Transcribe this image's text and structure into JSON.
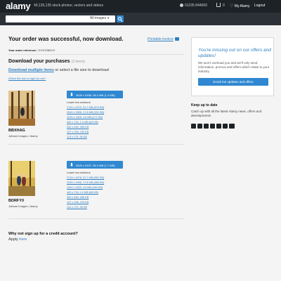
{
  "header": {
    "logo": "alamy",
    "tagline": "49,135,135 stock photos, vectors and videos",
    "phone": "01235 844600",
    "cart_count": "0",
    "my_alamy": "My Alamy",
    "logout": "Logout"
  },
  "search": {
    "value": "",
    "category": "All images"
  },
  "page": {
    "title": "Your order was successful, now download.",
    "printable_invoice": "Printable invoice",
    "order_reference_label": "Your order reference",
    "order_reference": "GYS72B5YG",
    "downloads_heading": "Download your purchases",
    "downloads_count": "(2 items)",
    "download_multiple": "Download multiple items",
    "download_multiple_suffix": "or select a file size to download",
    "which_size": "Which file size is right for me?",
    "credit_question": "Why not sign up for a credit account?",
    "apply_prefix": "Apply",
    "apply_link": "here"
  },
  "items": [
    {
      "id": "BBXHAG",
      "credit": "Jotham Images / Alamy",
      "main_download": "3626 x 5456, 56.4 MB (1.4 MB)",
      "lower_title": "Lower res versions",
      "lower_res": [
        "2720 x 4079, 31.7 MB (870 KB)",
        "2040 x 3058, 17.8 MB (531 KB)",
        "1020 x 1529, 4.5 MB (171 KB)",
        "490 x 734, 1.0 MB (63 KB)",
        "300 x 450, 396 KB",
        "197 x 296, 153 KB",
        "113 x 170, 56 KB"
      ]
    },
    {
      "id": "BDRFY0",
      "credit": "Jotham Images / Alamy",
      "main_download": "3625 x 5437, 56.4 MB (1.7 MB)",
      "lower_title": "Lower res versions",
      "lower_res": [
        "2719 x 4078, 31.7 MB (862 KB)",
        "2039 x 3058, 17.8 MB (588 KB)",
        "1020 x 1529, 4.5 MB (180 KB)",
        "490 x 734, 1.0 MB (66 KB)",
        "300 x 450, 396 KB",
        "197 x 296, 153 KB",
        "113 x 170, 56 KB"
      ]
    }
  ],
  "promo": {
    "title": "You're missing out on our offers and updates!",
    "text": "We won't overload you and we'll only send information, promos and offers which relate to your industry.",
    "button": "Email me updates and offers"
  },
  "keep_up": {
    "title": "Keep up to date",
    "text": "Catch up with all the latest Alamy news, offers and developments",
    "social_icons": [
      "facebook-icon",
      "twitter-icon",
      "pinterest-icon",
      "instagram-icon",
      "linkedin-icon",
      "google-plus-icon",
      "blog-icon"
    ]
  },
  "colors": {
    "header_bg": "#1d2226",
    "accent_blue": "#2f88d1",
    "link_blue": "#2f7fc1"
  }
}
